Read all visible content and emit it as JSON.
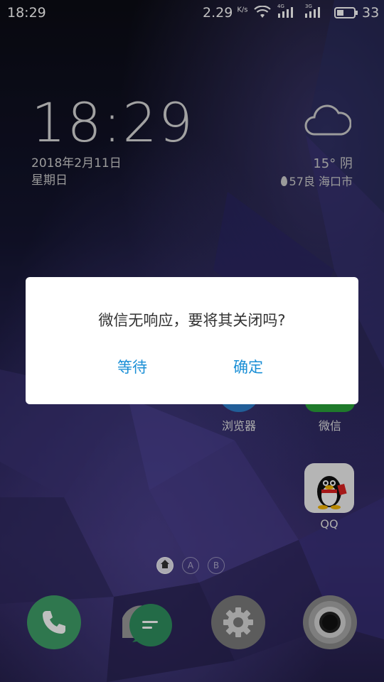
{
  "status_bar": {
    "time": "18:29",
    "net_speed": "2.29",
    "net_speed_unit": "K/s",
    "signal_1_label": "4G",
    "signal_2_label": "3G",
    "battery_level": "33"
  },
  "lockscreen": {
    "clock": "18:29",
    "date": "2018年2月11日",
    "weekday": "星期日",
    "weather": {
      "icon": "cloud-icon",
      "temperature_condition": "15° 阴",
      "aqi_location": "57良 海口市"
    }
  },
  "apps": {
    "browser": "浏览器",
    "wechat": "微信",
    "qq": "QQ"
  },
  "pager": {
    "a": "A",
    "b": "B"
  },
  "dock": [
    "phone-icon",
    "messages-icon",
    "settings-icon",
    "camera-icon"
  ],
  "dialog": {
    "message": "微信无响应，要将其关闭吗?",
    "wait_label": "等待",
    "confirm_label": "确定"
  },
  "colors": {
    "dialog_button": "#1a8fd6",
    "phone": "#3f9f68",
    "messages": "#2f8f5f",
    "settings": "#7b7b7b",
    "camera": "#8a8a8a"
  }
}
